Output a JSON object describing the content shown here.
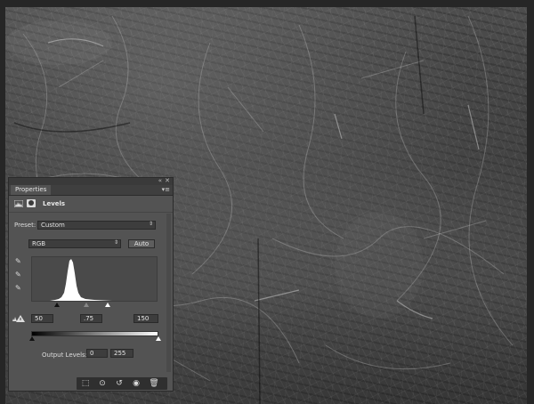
{
  "panel": {
    "tab_label": "Properties",
    "adjustment_title": "Levels",
    "preset_label": "Preset:",
    "preset_value": "Custom",
    "channel_value": "RGB",
    "auto_label": "Auto",
    "input_black": "50",
    "input_gamma": ".75",
    "input_white": "150",
    "output_label": "Output Levels:",
    "output_black": "0",
    "output_white": "255"
  },
  "icons": {
    "collapse": "double-chevron-left-icon",
    "close": "close-icon",
    "menu": "panel-menu-icon",
    "levels": "levels-histogram-icon",
    "mask": "mask-icon",
    "black_eyedropper": "black-point-eyedropper-icon",
    "gray_eyedropper": "gray-point-eyedropper-icon",
    "white_eyedropper": "white-point-eyedropper-icon",
    "clip_warning": "clipping-warning-icon",
    "clip_to_layer": "clip-to-layer-icon",
    "view_previous": "view-previous-state-icon",
    "reset": "reset-icon",
    "visibility": "eye-icon",
    "delete": "trash-icon"
  },
  "colors": {
    "panel_bg": "#535353",
    "field_bg": "#3d3d3d",
    "canvas_bg": "#262626"
  }
}
